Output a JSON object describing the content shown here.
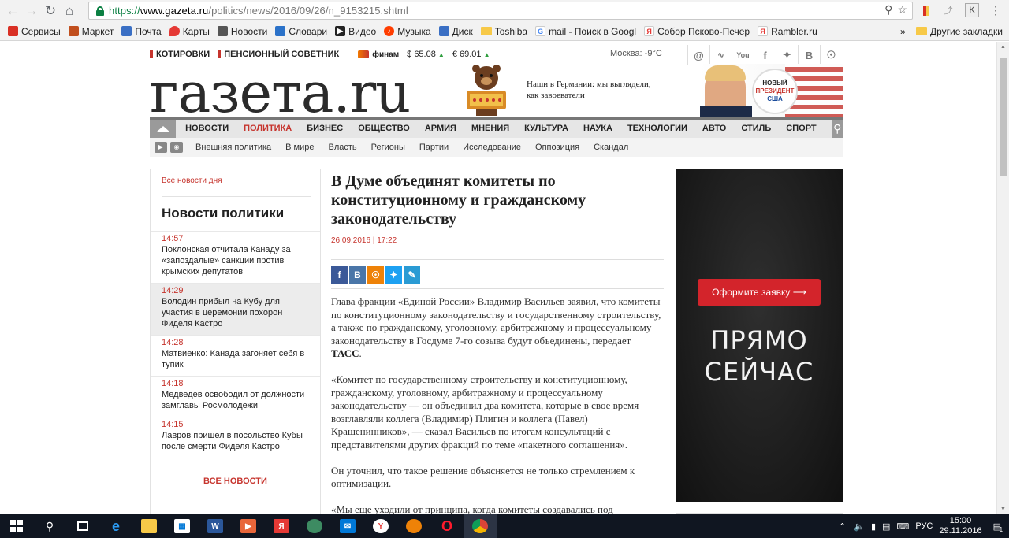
{
  "browser": {
    "url_scheme": "https://",
    "url_host": "www.gazeta.ru",
    "url_path": "/politics/news/2016/09/26/n_9153215.shtml",
    "bookmarks": [
      {
        "label": "Сервисы",
        "icon": "apps-icon",
        "color": "#d93025"
      },
      {
        "label": "Маркет",
        "icon": "market-icon",
        "color": "#c14f1e"
      },
      {
        "label": "Почта",
        "icon": "mail-icon",
        "color": "#3a6fc4"
      },
      {
        "label": "Карты",
        "icon": "map-pin-icon",
        "color": "#e53935"
      },
      {
        "label": "Новости",
        "icon": "news-icon",
        "color": "#555555"
      },
      {
        "label": "Словари",
        "icon": "book-icon",
        "color": "#2b72c9"
      },
      {
        "label": "Видео",
        "icon": "play-icon",
        "color": "#222222"
      },
      {
        "label": "Музыка",
        "icon": "music-icon",
        "color": "#ff3d00"
      },
      {
        "label": "Диск",
        "icon": "disk-icon",
        "color": "#3a6fc4"
      },
      {
        "label": "Toshiba",
        "icon": "folder-icon",
        "color": "#f7c948"
      },
      {
        "label": "mail - Поиск в Googl",
        "icon": "google-icon",
        "color": "#4285f4"
      },
      {
        "label": "Собор Псково-Печер",
        "icon": "yandex-icon",
        "color": "#e53935"
      },
      {
        "label": "Rambler.ru",
        "icon": "yandex-icon",
        "color": "#e53935"
      }
    ],
    "more": "»",
    "other_bookmarks": "Другие закладки"
  },
  "site": {
    "top_links": [
      "КОТИРОВКИ",
      "ПЕНСИОННЫЙ СОВЕТНИК"
    ],
    "finam": "финам",
    "usd": "$ 65.08",
    "eur": "€ 69.01",
    "weather": "Москва:  -9°C",
    "social": [
      "@",
      "rss",
      "yt",
      "f",
      "tw",
      "В",
      "ok"
    ],
    "logo": "газета.ru",
    "promo_text": "Наши в Германии: мы выглядели, как завоеватели",
    "badge": [
      "НОВЫЙ",
      "ПРЕЗИДЕНТ",
      "США"
    ],
    "nav": [
      "НОВОСТИ",
      "ПОЛИТИКА",
      "БИЗНЕС",
      "ОБЩЕСТВО",
      "АРМИЯ",
      "МНЕНИЯ",
      "КУЛЬТУРА",
      "НАУКА",
      "ТЕХНОЛОГИИ",
      "АВТО",
      "СТИЛЬ",
      "СПОРТ"
    ],
    "nav_active": "ПОЛИТИКА",
    "subnav": [
      "Внешняя политика",
      "В мире",
      "Власть",
      "Регионы",
      "Партии",
      "Исследование",
      "Оппозиция",
      "Скандал"
    ]
  },
  "sidebar": {
    "all_day": "Все новости дня",
    "title": "Новости политики",
    "items": [
      {
        "time": "14:57",
        "text": "Поклонская отчитала Канаду за «запоздалые» санкции против крымских депутатов"
      },
      {
        "time": "14:29",
        "text": "Володин прибыл на Кубу для участия в церемонии похорон Фиделя Кастро"
      },
      {
        "time": "14:28",
        "text": "Матвиенко: Канада загоняет себя в тупик"
      },
      {
        "time": "14:18",
        "text": "Медведев освободил от должности замглавы Росмолодежи"
      },
      {
        "time": "14:15",
        "text": "Лавров пришел в посольство Кубы после смерти Фиделя Кастро"
      }
    ],
    "all_news": "ВСЕ НОВОСТИ"
  },
  "article": {
    "title": "В Думе объединят комитеты по конституционному и гражданскому законодательству",
    "date": "26.09.2016 | 17:22",
    "p1": "Глава фракции «Единой России» Владимир Васильев заявил, что комитеты по конституционному законодательству и государственному строительству, а также по гражданскому, уголовному, арбитражному и процессуальному законодательству в Госдуме 7-го созыва будут объединены, передает ",
    "p1_source": "ТАСС",
    "p2": "«Комитет по государственному строительству и конституционному, гражданскому, уголовному, арбитражному и процессуальному законодательству — он объединил два комитета, которые в свое время возглавляли коллега (Владимир) Плигин и коллега (Павел) Крашенинников», — сказал Васильев по итогам консультаций с представителями других фракций по теме «пакетного соглашения».",
    "p3": "Он уточнил, что такое решение объясняется не только стремлением к оптимизации.",
    "p4": "«Мы еще уходили от принципа, когда комитеты создавались под"
  },
  "ad": {
    "button": "Оформите заявку ⟶",
    "line1": "ПРЯМО",
    "line2": "СЕЙЧАС"
  },
  "taskbar": {
    "lang": "РУС",
    "time": "15:00",
    "date": "29.11.2016",
    "notif_count": "1"
  }
}
